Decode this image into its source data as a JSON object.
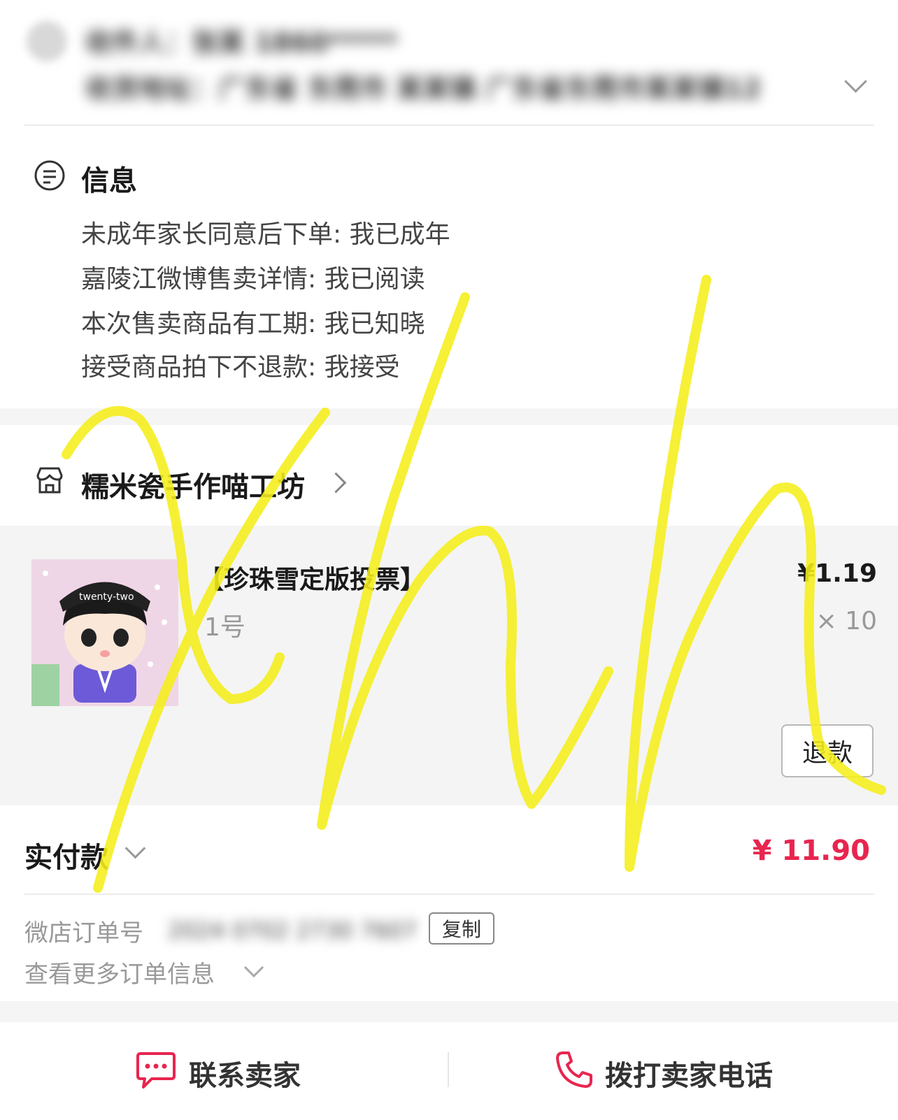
{
  "address": {
    "line1": "收件人：张某 1860*****",
    "line2": "收货地址：广东省 东莞市 某某镇 广东省东莞市某某镇12"
  },
  "info": {
    "title": "信息",
    "lines": [
      "未成年家长同意后下单: 我已成年",
      "嘉陵江微博售卖详情: 我已阅读",
      "本次售卖商品有工期: 我已知晓",
      "接受商品拍下不退款: 我接受"
    ]
  },
  "shop": {
    "name": "糯米瓷手作喵工坊"
  },
  "product": {
    "title": "【珍珠雪定版投票】",
    "variant": "1号",
    "price": "¥1.19",
    "quantity": "× 10",
    "refund_label": "退款",
    "thumb_hat_text": "twenty-two"
  },
  "payment": {
    "label": "实付款",
    "amount": "¥ 11.90",
    "amount_color": "#e8254f"
  },
  "order": {
    "number_label": "微店订单号",
    "number_value": "2024 0702 2730 7607",
    "copy_label": "复制",
    "more_label": "查看更多订单信息"
  },
  "bottom_bar": {
    "contact_label": "联系卖家",
    "call_label": "拨打卖家电话",
    "icon_color": "#e8254f"
  },
  "icons": [
    "info-icon",
    "shop-icon",
    "chat-icon",
    "phone-icon",
    "chevron-down-icon",
    "chevron-right-icon"
  ],
  "overlay": {
    "handwriting_color": "#f5ee1a"
  }
}
